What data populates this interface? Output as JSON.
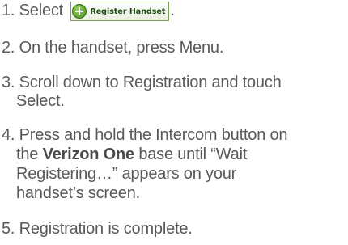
{
  "steps": [
    {
      "num": "1.",
      "pre": "Select",
      "button_label": "Register Handset",
      "post": "."
    },
    {
      "num": "2.",
      "text": "On the handset, press Menu."
    },
    {
      "num": "3.",
      "line1": "Scroll down to Registration and touch",
      "line2": "Select."
    },
    {
      "num": "4.",
      "line1": "Press and hold the Intercom button on",
      "line2_pre": "the",
      "line2_bold": "Verizon One",
      "line2_post": "base until “Wait",
      "line3": "Registering…” appears on your",
      "line4": "handset’s screen."
    },
    {
      "num": "5.",
      "text": "Registration is complete."
    }
  ],
  "icons": {
    "register_button_icon": "plus-circle-icon"
  },
  "colors": {
    "text": "#58595b",
    "button_icon": "#3f8f1a",
    "button_border": "#7d9a54"
  }
}
